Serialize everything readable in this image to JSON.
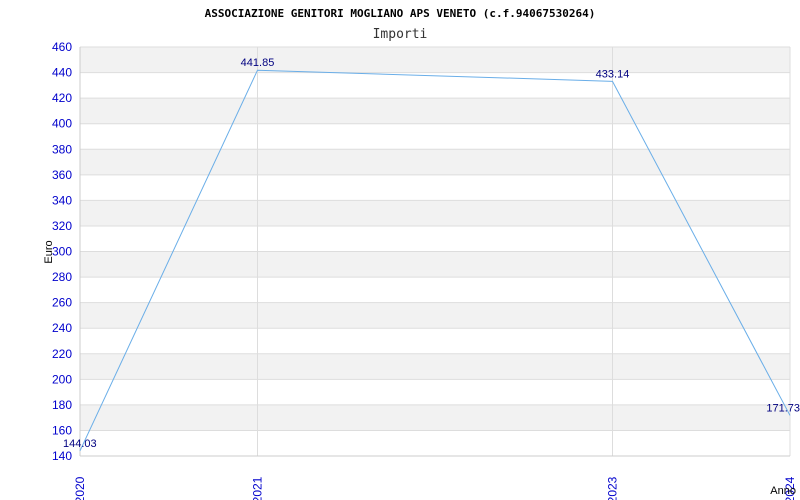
{
  "chart_data": {
    "type": "line",
    "title": "ASSOCIAZIONE GENITORI MOGLIANO APS VENETO (c.f.94067530264)",
    "subtitle": "Importi",
    "xlabel": "Anno",
    "ylabel": "Euro",
    "ylim": [
      140,
      460
    ],
    "y_ticks": [
      "140",
      "160",
      "180",
      "200",
      "220",
      "240",
      "260",
      "280",
      "300",
      "320",
      "340",
      "360",
      "380",
      "400",
      "420",
      "440",
      "460"
    ],
    "x": [
      "2020",
      "2021",
      "2023",
      "2024"
    ],
    "values": [
      144.03,
      441.85,
      433.14,
      171.73
    ],
    "value_labels": [
      "144.03",
      "441.85",
      "433.14",
      "171.73"
    ],
    "grid": true,
    "colors": {
      "line": "#6aaee8",
      "band": "#f2f2f2",
      "grid": "#dddddd",
      "tick": "#0000cc",
      "data_label": "#000080"
    }
  }
}
